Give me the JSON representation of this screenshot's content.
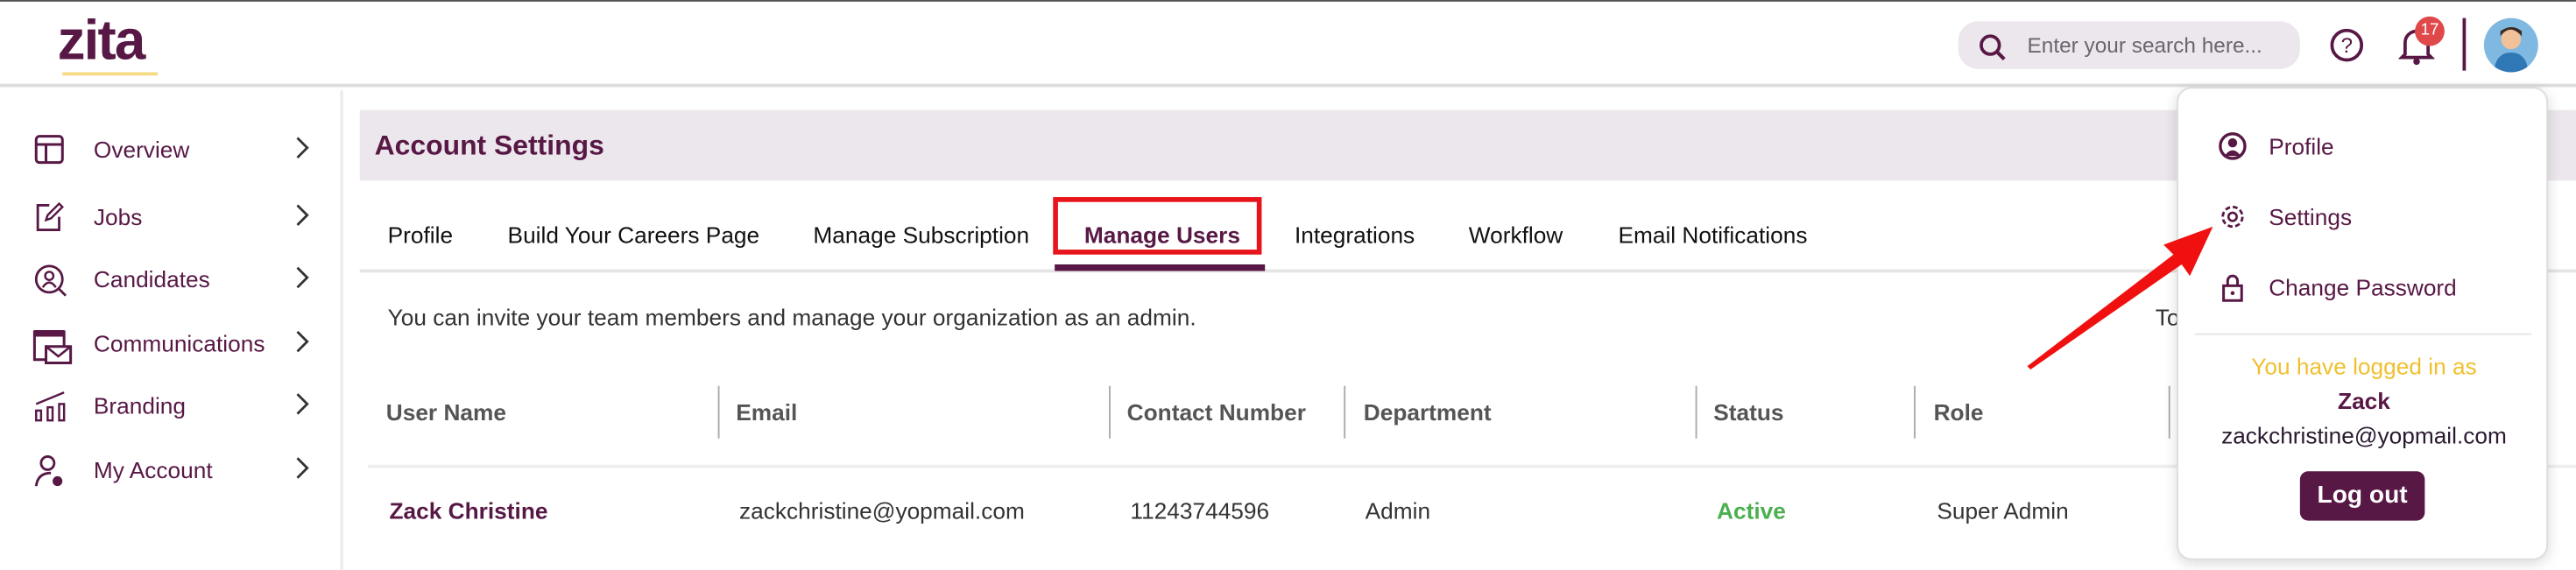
{
  "header": {
    "logo": "zita",
    "search_placeholder": "Enter your search here...",
    "notification_count": "17"
  },
  "sidebar": {
    "items": [
      {
        "label": "Overview",
        "icon": "layout-icon"
      },
      {
        "label": "Jobs",
        "icon": "edit-icon"
      },
      {
        "label": "Candidates",
        "icon": "candidate-search-icon"
      },
      {
        "label": "Communications",
        "icon": "calendar-mail-icon"
      },
      {
        "label": "Branding",
        "icon": "chart-icon"
      },
      {
        "label": "My Account",
        "icon": "user-gear-icon"
      }
    ]
  },
  "main": {
    "title": "Account Settings",
    "tabs": [
      "Profile",
      "Build Your Careers Page",
      "Manage Subscription",
      "Manage Users",
      "Integrations",
      "Workflow",
      "Email Notifications"
    ],
    "active_tab": "Manage Users",
    "description": "You can invite your team members and manage your organization as an admin.",
    "truncated_text": "To",
    "table": {
      "headers": [
        "User Name",
        "Email",
        "Contact Number",
        "Department",
        "Status",
        "Role"
      ],
      "rows": [
        {
          "name": "Zack Christine",
          "email": "zackchristine@yopmail.com",
          "contact": "11243744596",
          "department": "Admin",
          "status": "Active",
          "role": "Super Admin"
        }
      ]
    }
  },
  "dropdown": {
    "items": [
      "Profile",
      "Settings",
      "Change Password"
    ],
    "logged_in_label": "You have logged in as",
    "user_name": "Zack",
    "user_email": "zackchristine@yopmail.com",
    "logout": "Log out"
  },
  "colors": {
    "brand": "#581845",
    "active_status": "#4caf50",
    "highlight": "#e8141b",
    "logged_in_text": "#f0c030"
  }
}
